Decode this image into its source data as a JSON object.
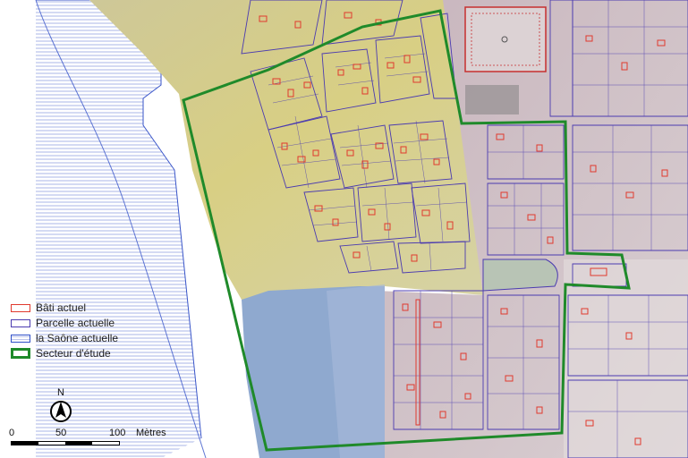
{
  "map": {
    "legend": [
      {
        "key": "bati",
        "label": "Bâti actuel",
        "color": "#e03a2e"
      },
      {
        "key": "parcelle",
        "label": "Parcelle actuelle",
        "color": "#4b3bb0"
      },
      {
        "key": "saone",
        "label": "la Saône actuelle",
        "color": "#2f4fc9"
      },
      {
        "key": "secteur",
        "label": "Secteur d'étude",
        "color": "#1f8a2a"
      }
    ],
    "north_label": "N",
    "scale": {
      "labels": [
        "0",
        "50",
        "100"
      ],
      "unit": "Mètres"
    },
    "colors": {
      "study_area": "#1f8a2a",
      "parcel_line": "#4b3bb0",
      "building": "#e03a2e",
      "river_hatch": "#2f4fc9",
      "old_map_yellow": "#d9d08a",
      "old_map_pink": "#c9b4bd",
      "water_blue": "#8fa9cf"
    }
  }
}
